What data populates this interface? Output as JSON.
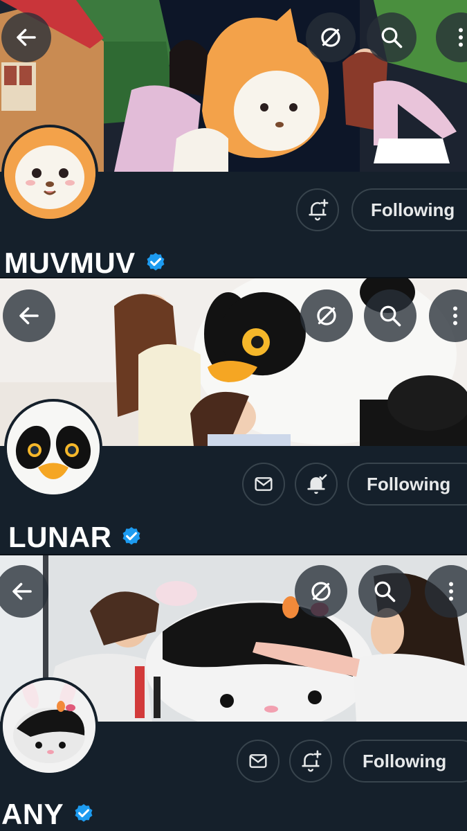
{
  "profiles": [
    {
      "name": "MUVMUV",
      "follow_label": "Following",
      "buttons": [
        "bell-plus-icon"
      ],
      "banner_colors": {
        "bg": "#27312a",
        "accent": "#f2a23c",
        "house": "#c99053"
      }
    },
    {
      "name": "LUNAR",
      "follow_label": "Following",
      "buttons": [
        "mail-icon",
        "bell-check-icon"
      ],
      "banner_colors": {
        "bg": "#f4f1ee",
        "accent": "#f5b72a",
        "panda": "#111111"
      }
    },
    {
      "name": "ANY",
      "follow_label": "Following",
      "buttons": [
        "mail-icon",
        "bell-plus-icon"
      ],
      "banner_colors": {
        "bg": "#dfe2e4",
        "accent": "#e05a7a",
        "plush": "#f1f1f1"
      }
    }
  ],
  "theme": {
    "panel_bg": "#15202b",
    "border": "#38444d",
    "verified": "#1d9bf0",
    "text": "#e7e9ea"
  },
  "toolbar_icons": [
    "back-arrow-icon",
    "grok-icon",
    "search-icon",
    "more-icon"
  ]
}
